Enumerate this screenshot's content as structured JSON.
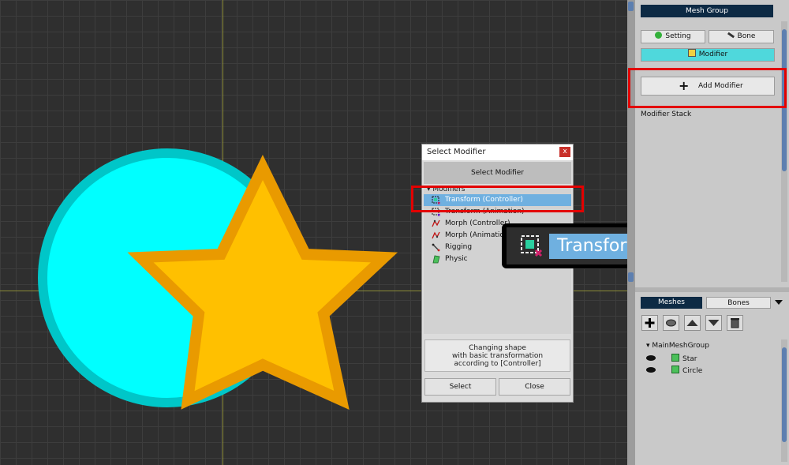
{
  "dialog": {
    "title": "Select Modifier",
    "close_glyph": "x",
    "header": "Select Modifier",
    "tree_root": "▾ Modifiers",
    "items": [
      {
        "label": "Transform (Controller)",
        "icon": "transform-controller-icon"
      },
      {
        "label": "Transform (Animation)",
        "icon": "transform-animation-icon"
      },
      {
        "label": "Morph (Controller)",
        "icon": "morph-controller-icon"
      },
      {
        "label": "Morph (Animation)",
        "icon": "morph-animation-icon"
      },
      {
        "label": "Rigging",
        "icon": "rigging-icon"
      },
      {
        "label": "Physic",
        "icon": "physic-icon"
      }
    ],
    "selected_index": 0,
    "description": [
      "Changing shape",
      "with basic transformation",
      "according to [Controller]"
    ],
    "select_button": "Select",
    "close_button": "Close"
  },
  "zoom_callout": {
    "label": "Transform (Controller)"
  },
  "panel": {
    "title": "Mesh Group",
    "setting_button": "Setting",
    "bone_button": "Bone",
    "modifier_button": "Modifier",
    "add_modifier_button": "Add Modifier",
    "modifier_stack_label": "Modifier Stack",
    "tabs": {
      "meshes": "Meshes",
      "bones": "Bones"
    },
    "tree": {
      "root": "MainMeshGroup",
      "children": [
        "Star",
        "Circle"
      ]
    }
  },
  "colors": {
    "circle_fill": "#00FFFF",
    "circle_stroke": "#00C6C8",
    "star_fill": "#FFC000",
    "star_stroke": "#E99A00",
    "selection": "#6FB0E0",
    "highlight_red": "#E30000",
    "accent_cyan": "#4FD8DC"
  }
}
